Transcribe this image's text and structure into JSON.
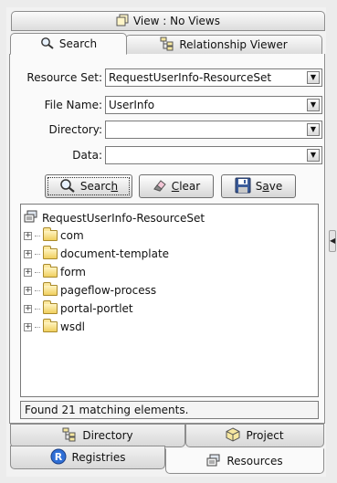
{
  "tabs_top": {
    "view_label": "View : No Views",
    "search_label": "Search",
    "relationship_label": "Relationship Viewer"
  },
  "form": {
    "resource_set": {
      "label": "Resource Set:",
      "value": "RequestUserInfo-ResourceSet"
    },
    "file_name": {
      "label": "File Name:",
      "value": "UserInfo"
    },
    "directory": {
      "label": "Directory:",
      "value": ""
    },
    "data": {
      "label": "Data:",
      "value": ""
    }
  },
  "buttons": {
    "search": {
      "pre": "Searc",
      "mnemonic": "h",
      "post": ""
    },
    "clear": {
      "pre": "",
      "mnemonic": "C",
      "post": "lear"
    },
    "save": {
      "pre": "S",
      "mnemonic": "a",
      "post": "ve"
    }
  },
  "tree": {
    "root": "RequestUserInfo-ResourceSet",
    "items": [
      "com",
      "document-template",
      "form",
      "pageflow-process",
      "portal-portlet",
      "wsdl"
    ]
  },
  "status": "Found 21 matching elements.",
  "tabs_bottom": {
    "directory": "Directory",
    "project": "Project",
    "registries": "Registries",
    "resources": "Resources"
  },
  "colors": {
    "folder": "#f0cf5e",
    "registries_icon": "#2f6fd6"
  },
  "icons": {
    "view": "view-icon",
    "search": "magnifier-icon",
    "relationship": "relationship-icon",
    "clear": "eraser-icon",
    "save": "floppy-disk-icon",
    "root": "resource-set-icon",
    "folder": "folder-icon"
  }
}
